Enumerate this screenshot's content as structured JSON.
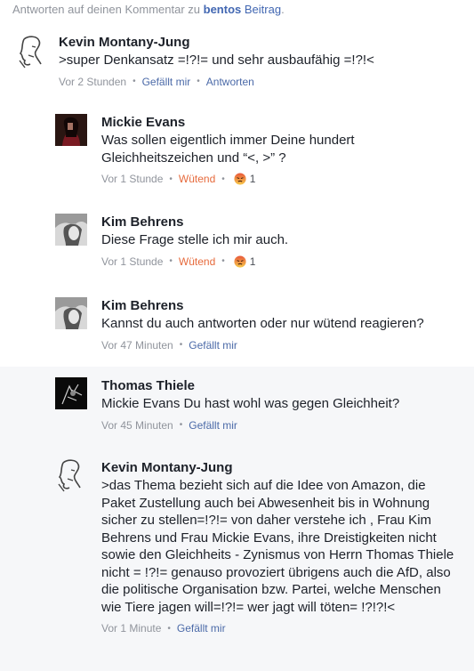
{
  "header": {
    "prefix": "Antworten auf deinen Kommentar zu",
    "link_author": "bentos",
    "link_post": "Beitrag",
    "suffix": "."
  },
  "comments": [
    {
      "name": "Kevin Montany-Jung",
      "text": ">super Denkansatz =!?!= und sehr ausbaufähig =!?!<",
      "time": "Vor 2 Stunden",
      "like_label": "Gefällt mir",
      "reply_label": "Antworten"
    },
    {
      "name": "Mickie Evans",
      "text": "Was sollen eigentlich immer Deine hundert Gleichheitszeichen und “<, >” ?",
      "time": "Vor 1 Stunde",
      "reaction_label": "Wütend",
      "reaction_count": "1"
    },
    {
      "name": "Kim Behrens",
      "text": "Diese Frage stelle ich mir auch.",
      "time": "Vor 1 Stunde",
      "reaction_label": "Wütend",
      "reaction_count": "1"
    },
    {
      "name": "Kim Behrens",
      "text": "Kannst du auch antworten oder nur wütend reagieren?",
      "time": "Vor 47 Minuten",
      "like_label": "Gefällt mir"
    },
    {
      "name": "Thomas Thiele",
      "text": "Mickie Evans Du hast wohl was gegen Gleichheit?",
      "time": "Vor 45 Minuten",
      "like_label": "Gefällt mir"
    },
    {
      "name": "Kevin Montany-Jung",
      "text": ">das Thema bezieht sich auf die Idee von Amazon, die Paket Zustellung auch bei Abwesenheit bis in Wohnung sicher zu stellen=!?!= von daher verstehe ich , Frau Kim Behrens und Frau Mickie Evans,  ihre Dreistigkeiten nicht sowie den Gleichheits - Zynismus von Herrn Thomas Thiele nicht = !?!= genauso provoziert übrigens auch die AfD, also die politische Organisation bzw. Partei, welche Menschen wie Tiere jagen will=!?!= wer jagt will töten= !?!?!<",
      "time": "Vor 1 Minute",
      "like_label": "Gefällt mir"
    }
  ],
  "colors": {
    "link": "#4267b2",
    "meta": "#90949c",
    "angry": "#e66a3c",
    "highlight_bg": "#f6f7f9"
  },
  "icons": [
    "sketch-face-avatar",
    "photo-avatar-mickie",
    "photo-avatar-kim",
    "photo-avatar-thomas",
    "angry-face-icon"
  ]
}
